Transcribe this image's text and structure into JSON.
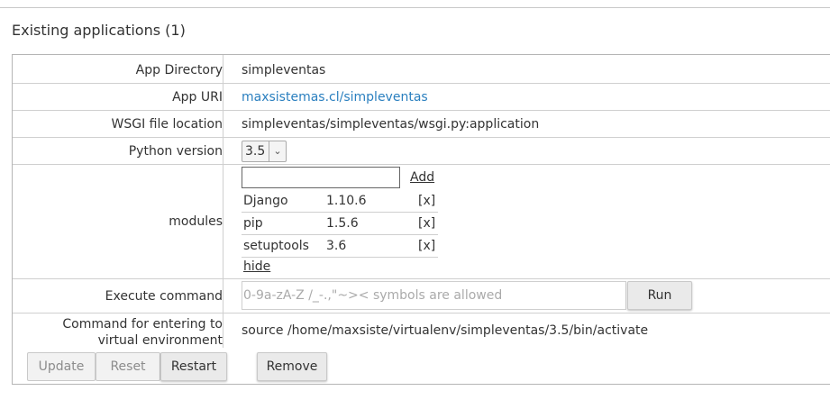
{
  "section": {
    "title": "Existing applications (1)"
  },
  "details": {
    "app_directory": {
      "label": "App Directory",
      "value": "simpleventas"
    },
    "app_uri": {
      "label": "App URI",
      "value": "maxsistemas.cl/simpleventas"
    },
    "wsgi": {
      "label": "WSGI file location",
      "value": "simpleventas/simpleventas/wsgi.py:application"
    },
    "python": {
      "label": "Python version",
      "selected": "3.5"
    },
    "modules": {
      "label": "modules",
      "input_value": "",
      "add_label": "Add",
      "items": [
        {
          "name": "Django",
          "version": "1.10.6",
          "remove": "[x]"
        },
        {
          "name": "pip",
          "version": "1.5.6",
          "remove": "[x]"
        },
        {
          "name": "setuptools",
          "version": "3.6",
          "remove": "[x]"
        }
      ],
      "hide_label": "hide"
    },
    "execute": {
      "label": "Execute command",
      "placeholder": "0-9a-zA-Z /_-.,\"~>< symbols are allowed",
      "run_label": "Run"
    },
    "venv": {
      "label_line1": "Command for entering to",
      "label_line2": "virtual environment",
      "value": "source /home/maxsiste/virtualenv/simpleventas/3.5/bin/activate"
    }
  },
  "actions": {
    "update": "Update",
    "reset": "Reset",
    "restart": "Restart",
    "remove": "Remove"
  }
}
